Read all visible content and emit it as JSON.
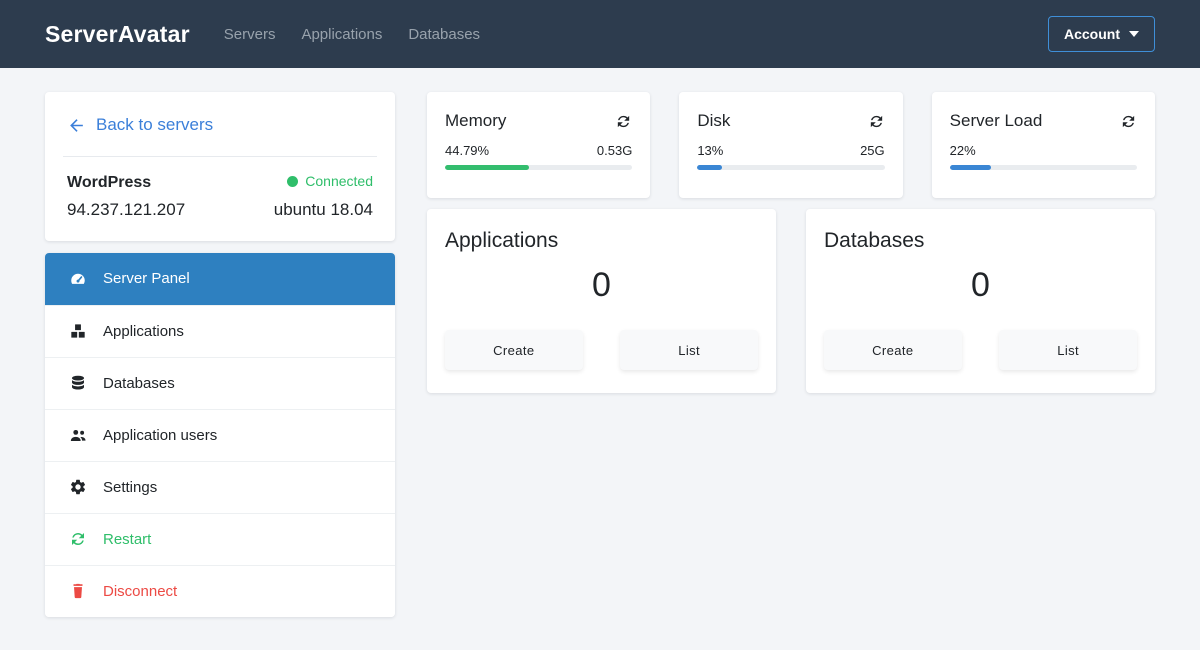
{
  "navbar": {
    "brand": "ServerAvatar",
    "links": [
      {
        "label": "Servers"
      },
      {
        "label": "Applications"
      },
      {
        "label": "Databases"
      }
    ],
    "account_label": "Account"
  },
  "server_card": {
    "back_link": "Back to servers",
    "name": "WordPress",
    "status": "Connected",
    "ip": "94.237.121.207",
    "os": "ubuntu 18.04"
  },
  "sidebar": {
    "items": [
      {
        "label": "Server Panel",
        "icon": "tachometer-icon",
        "state": "active"
      },
      {
        "label": "Applications",
        "icon": "cubes-icon",
        "state": "normal"
      },
      {
        "label": "Databases",
        "icon": "database-icon",
        "state": "normal"
      },
      {
        "label": "Application users",
        "icon": "users-icon",
        "state": "normal"
      },
      {
        "label": "Settings",
        "icon": "cogs-icon",
        "state": "normal"
      },
      {
        "label": "Restart",
        "icon": "sync-icon",
        "state": "green"
      },
      {
        "label": "Disconnect",
        "icon": "trash-icon",
        "state": "red"
      }
    ]
  },
  "stats": [
    {
      "title": "Memory",
      "percent": "44.79%",
      "value": "0.53G",
      "fill": 44.79,
      "bar_color": "#33bd6e"
    },
    {
      "title": "Disk",
      "percent": "13%",
      "value": "25G",
      "fill": 13,
      "bar_color": "#3a86d4"
    },
    {
      "title": "Server Load",
      "percent": "22%",
      "value": "",
      "fill": 22,
      "bar_color": "#3a86d4"
    }
  ],
  "panels": [
    {
      "title": "Applications",
      "count": "0",
      "create_label": "Create",
      "list_label": "List"
    },
    {
      "title": "Databases",
      "count": "0",
      "create_label": "Create",
      "list_label": "List"
    }
  ],
  "colors": {
    "navbar_bg": "#2d3c4e",
    "accent_blue": "#3b7fd9",
    "active_item_bg": "#2e80c0",
    "success_green": "#2fbe6a",
    "danger_red": "#ec4a44",
    "progress_blue": "#3a86d4",
    "progress_green": "#33bd6e",
    "page_bg": "#f3f5f8",
    "card_bg": "#ffffff"
  }
}
